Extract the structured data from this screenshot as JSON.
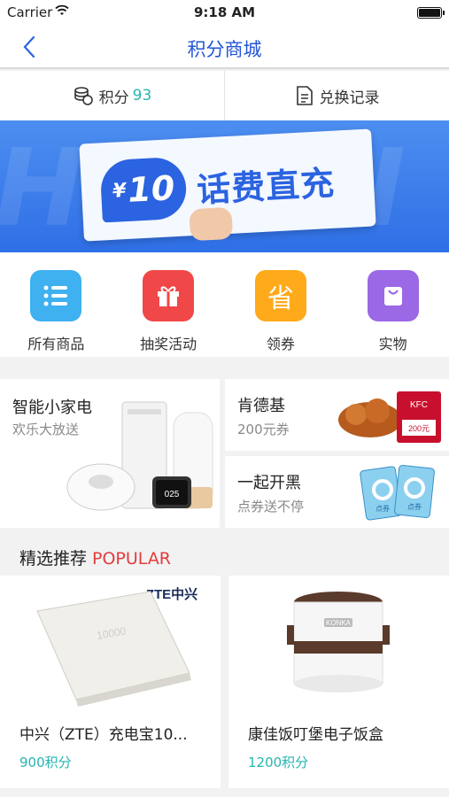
{
  "status": {
    "carrier": "Carrier",
    "time": "9:18 AM"
  },
  "nav": {
    "title": "积分商城"
  },
  "info": {
    "points_label": "积分",
    "points_value": "93",
    "record_label": "兑换记录"
  },
  "banner": {
    "currency": "¥",
    "amount": "10",
    "text": "话费直充"
  },
  "categories": [
    {
      "label": "所有商品",
      "color": "#3fb0f0",
      "icon": "list-icon"
    },
    {
      "label": "抽奖活动",
      "color": "#f04848",
      "icon": "gift-icon"
    },
    {
      "label": "领券",
      "color": "#ffaa1a",
      "icon": "coupon-icon",
      "glyph": "省"
    },
    {
      "label": "实物",
      "color": "#9b68e6",
      "icon": "bag-icon"
    }
  ],
  "promos": {
    "appliance": {
      "title": "智能小家电",
      "subtitle": "欢乐大放送",
      "screen_text": "025"
    },
    "kfc": {
      "title": "肯德基",
      "subtitle": "200元券",
      "tag": "KFC",
      "tag_value": "200元"
    },
    "game": {
      "title": "一起开黑",
      "subtitle": "点券送不停",
      "card_text": "点券"
    }
  },
  "section": {
    "title_cn": "精选推荐",
    "title_en": "POPULAR"
  },
  "products": [
    {
      "name": "中兴（ZTE）充电宝10...",
      "price": "900积分",
      "brand": "ZTE中兴",
      "device_text": "10000"
    },
    {
      "name": "康佳饭叮堡电子饭盒",
      "price": "1200积分",
      "brand": "KONKA"
    }
  ]
}
